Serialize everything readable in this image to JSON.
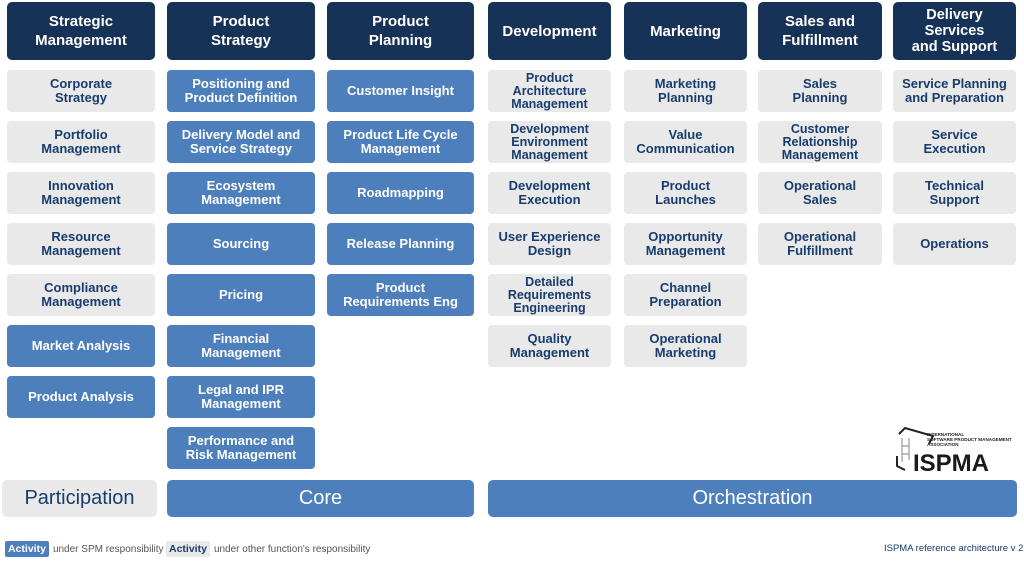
{
  "colors": {
    "header": "#173257",
    "spm": "#4e7fbd",
    "other": "#e9e9e9",
    "other_text": "#173c6d"
  },
  "columns": [
    {
      "title": "Strategic\nManagement",
      "items": [
        {
          "label": "Corporate\nStrategy",
          "type": "other"
        },
        {
          "label": "Portfolio\nManagement",
          "type": "other"
        },
        {
          "label": "Innovation\nManagement",
          "type": "other"
        },
        {
          "label": "Resource\nManagement",
          "type": "other"
        },
        {
          "label": "Compliance\nManagement",
          "type": "other"
        },
        {
          "label": "Market Analysis",
          "type": "spm"
        },
        {
          "label": "Product Analysis",
          "type": "spm"
        }
      ]
    },
    {
      "title": "Product\nStrategy",
      "items": [
        {
          "label": "Positioning and\nProduct Definition",
          "type": "spm"
        },
        {
          "label": "Delivery Model and\nService Strategy",
          "type": "spm"
        },
        {
          "label": "Ecosystem\nManagement",
          "type": "spm"
        },
        {
          "label": "Sourcing",
          "type": "spm"
        },
        {
          "label": "Pricing",
          "type": "spm"
        },
        {
          "label": "Financial\nManagement",
          "type": "spm"
        },
        {
          "label": "Legal and IPR\nManagement",
          "type": "spm"
        },
        {
          "label": "Performance and\nRisk Management",
          "type": "spm"
        }
      ]
    },
    {
      "title": "Product\nPlanning",
      "items": [
        {
          "label": "Customer Insight",
          "type": "spm"
        },
        {
          "label": "Product Life Cycle\nManagement",
          "type": "spm"
        },
        {
          "label": "Roadmapping",
          "type": "spm"
        },
        {
          "label": "Release Planning",
          "type": "spm"
        },
        {
          "label": "Product\nRequirements Eng",
          "type": "spm"
        }
      ]
    },
    {
      "title": "Development",
      "items": [
        {
          "label": "Product\nArchitecture\nManagement",
          "type": "other"
        },
        {
          "label": "Development\nEnvironment\nManagement",
          "type": "other"
        },
        {
          "label": "Development\nExecution",
          "type": "other"
        },
        {
          "label": "User Experience\nDesign",
          "type": "other"
        },
        {
          "label": "Detailed\nRequirements\nEngineering",
          "type": "other"
        },
        {
          "label": "Quality\nManagement",
          "type": "other"
        }
      ]
    },
    {
      "title": "Marketing",
      "items": [
        {
          "label": "Marketing\nPlanning",
          "type": "other"
        },
        {
          "label": "Value\nCommunication",
          "type": "other"
        },
        {
          "label": "Product\nLaunches",
          "type": "other"
        },
        {
          "label": "Opportunity\nManagement",
          "type": "other"
        },
        {
          "label": "Channel\nPreparation",
          "type": "other"
        },
        {
          "label": "Operational\nMarketing",
          "type": "other"
        }
      ]
    },
    {
      "title": "Sales and\nFulfillment",
      "items": [
        {
          "label": "Sales\nPlanning",
          "type": "other"
        },
        {
          "label": "Customer\nRelationship\nManagement",
          "type": "other"
        },
        {
          "label": "Operational\nSales",
          "type": "other"
        },
        {
          "label": "Operational\nFulfillment",
          "type": "other"
        }
      ]
    },
    {
      "title": "Delivery\nServices\nand Support",
      "items": [
        {
          "label": "Service Planning\nand Preparation",
          "type": "other"
        },
        {
          "label": "Service\nExecution",
          "type": "other"
        },
        {
          "label": "Technical\nSupport",
          "type": "other"
        },
        {
          "label": "Operations",
          "type": "other"
        }
      ]
    }
  ],
  "bands": [
    {
      "label": "Participation",
      "type": "other"
    },
    {
      "label": "Core",
      "type": "spm"
    },
    {
      "label": "Orchestration",
      "type": "spm"
    }
  ],
  "legend": {
    "chip_label": "Activity",
    "spm_text": "under SPM responsibility",
    "other_text": "under other function's responsibility"
  },
  "logo": {
    "name": "ISPMA",
    "subtitle_lines": [
      "INTERNATIONAL",
      "SOFTWARE PRODUCT MANAGEMENT",
      "ASSOCIATION"
    ],
    "icon": "building-frame-icon"
  },
  "version": "ISPMA reference architecture v 2"
}
